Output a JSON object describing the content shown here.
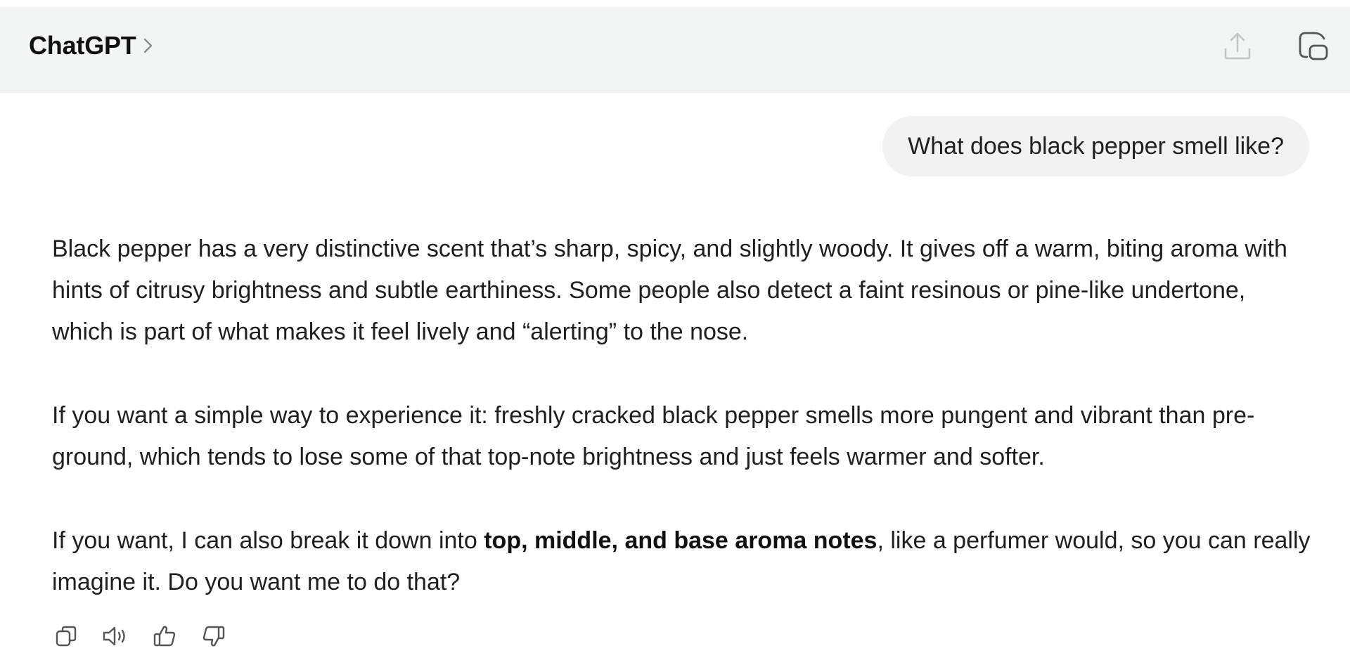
{
  "header": {
    "title": "ChatGPT",
    "chevron_icon": "chevron-right-icon",
    "share_icon": "share-upload-icon",
    "new_chat_icon": "new-chat-icon"
  },
  "conversation": {
    "user_message": "What does black pepper smell like?",
    "assistant_paragraphs": {
      "p1": "Black pepper has a very distinctive scent that’s sharp, spicy, and slightly woody. It gives off a warm, biting aroma with hints of citrusy brightness and subtle earthiness. Some people also detect a faint resinous or pine-like undertone, which is part of what makes it feel lively and “alerting” to the nose.",
      "p2": "If you want a simple way to experience it: freshly cracked black pepper smells more pungent and vibrant than pre-ground, which tends to lose some of that top-note brightness and just feels warmer and softer.",
      "p3_before": "If you want, I can also break it down into ",
      "p3_bold": "top, middle, and base aroma notes",
      "p3_after": ", like a perfumer would, so you can really imagine it. Do you want me to do that?"
    }
  },
  "message_actions": {
    "icons": [
      "copy-icon",
      "read-aloud-icon",
      "thumbs-up-icon",
      "thumbs-down-icon"
    ]
  },
  "colors": {
    "header_background": "#f3f4f4",
    "user_bubble_background": "#f2f2f2",
    "text": "#1f1f1f",
    "icon_muted": "#c4c4c4",
    "icon": "#555555"
  }
}
